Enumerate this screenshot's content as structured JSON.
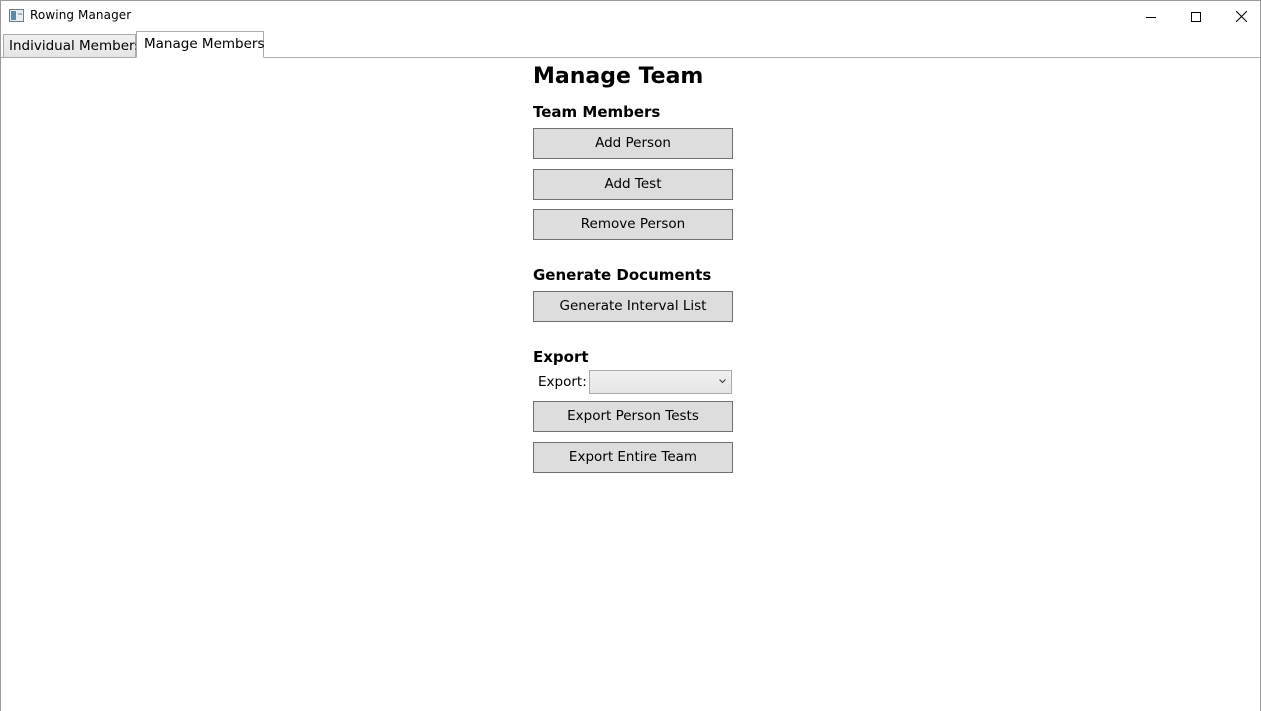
{
  "window": {
    "title": "Rowing Manager",
    "icon": "app-icon"
  },
  "tabs": [
    {
      "label": "Individual Members",
      "selected": false
    },
    {
      "label": "Manage Members",
      "selected": true
    }
  ],
  "main": {
    "heading": "Manage Team",
    "sections": {
      "team_members": {
        "heading": "Team Members",
        "buttons": [
          "Add Person",
          "Add Test",
          "Remove Person"
        ]
      },
      "generate_documents": {
        "heading": "Generate Documents",
        "buttons": [
          "Generate Interval List"
        ]
      },
      "export": {
        "heading": "Export",
        "field_label": "Export:",
        "field_value": "",
        "buttons": [
          "Export Person Tests",
          "Export Entire Team"
        ]
      }
    }
  },
  "colors": {
    "button_bg": "#dddddd",
    "button_border": "#707070",
    "tab_border": "#acacac"
  }
}
